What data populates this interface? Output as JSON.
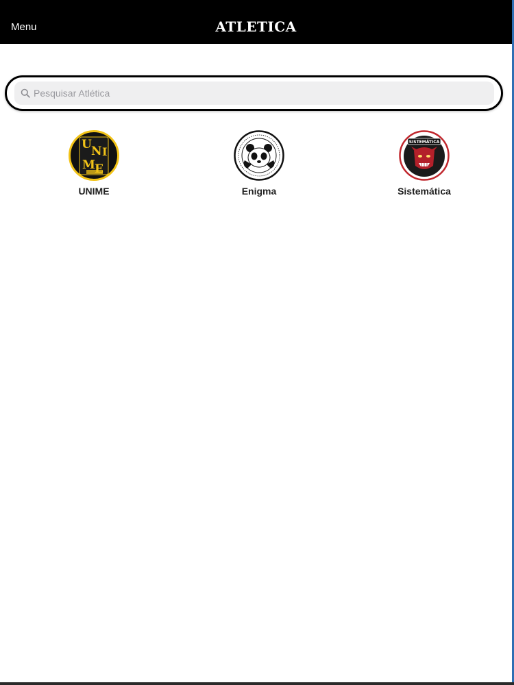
{
  "header": {
    "menu_label": "Menu",
    "title": "ATLETICA"
  },
  "search": {
    "placeholder": "Pesquisar Atlética",
    "value": "",
    "icon": "search-icon"
  },
  "teams": [
    {
      "name": "UNIME",
      "logo": "unime-logo",
      "logo_text": [
        "U",
        "N",
        "I",
        "M",
        "É"
      ],
      "colors": {
        "ring": "#f2c318",
        "bg": "#111111",
        "text": "#f2c318"
      }
    },
    {
      "name": "Enigma",
      "logo": "enigma-panda-logo",
      "colors": {
        "ring": "#111111",
        "bg": "#ffffff",
        "text": "#111111"
      }
    },
    {
      "name": "Sistemática",
      "logo": "sistematica-logo",
      "logo_text": "SISTEMÁTICA",
      "colors": {
        "ring": "#c0272d",
        "bg": "#111111",
        "text": "#ffffff"
      }
    }
  ]
}
